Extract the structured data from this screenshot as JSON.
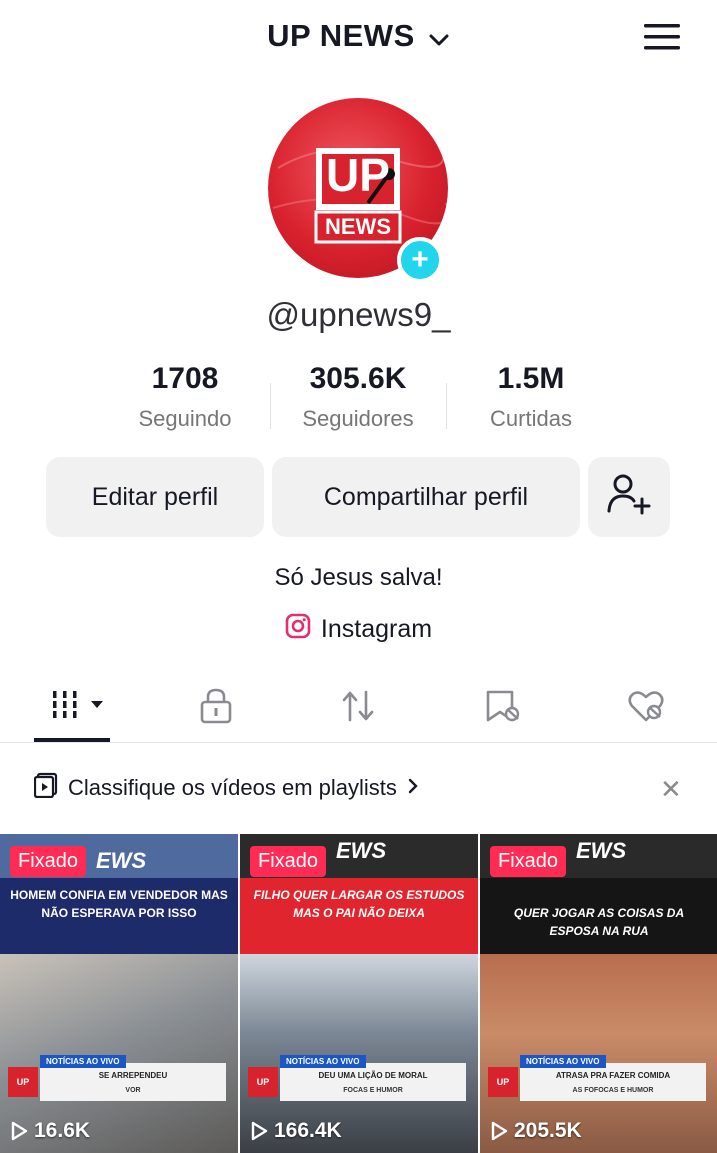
{
  "header": {
    "title": "UP NEWS"
  },
  "avatar": {
    "logo_top": "UP",
    "logo_bottom": "NEWS"
  },
  "profile": {
    "handle": "@upnews9_",
    "bio": "Só Jesus salva!",
    "link_label": "Instagram"
  },
  "stats": [
    {
      "value": "1708",
      "label": "Seguindo"
    },
    {
      "value": "305.6K",
      "label": "Seguidores"
    },
    {
      "value": "1.5M",
      "label": "Curtidas"
    }
  ],
  "buttons": {
    "edit": "Editar perfil",
    "share": "Compartilhar perfil"
  },
  "tabs": [
    "videos-grid-icon",
    "lock-icon",
    "repost-icon",
    "favorites-icon",
    "liked-hidden-icon"
  ],
  "playlist_prompt": "Classifique os vídeos em playlists",
  "videos": [
    {
      "pinned": "Fixado",
      "brand_tail": "EWS",
      "headline": "HOMEM CONFIA EM VENDEDOR MAS NÃO ESPERAVA POR ISSO",
      "tag": "NOTÍCIAS AO VIVO",
      "lower_text": "SE ARREPENDEU",
      "lower_sub": "VOR",
      "views": "16.6K"
    },
    {
      "pinned": "Fixado",
      "brand_tail": "EWS",
      "headline": "FILHO QUER LARGAR OS ESTUDOS MAS O PAI NÃO DEIXA",
      "tag": "NOTÍCIAS AO VIVO",
      "lower_text": "DEU UMA LIÇÃO DE MORAL",
      "lower_sub": "FOCAS E HUMOR",
      "views": "166.4K"
    },
    {
      "pinned": "Fixado",
      "brand_tail": "EWS",
      "headline": "QUER JOGAR AS COISAS DA ESPOSA NA RUA",
      "tag": "NOTÍCIAS AO VIVO",
      "lower_text": "ATRASA PRA FAZER COMIDA",
      "lower_sub": "AS FOFOCAS E HUMOR",
      "views": "205.5K"
    }
  ],
  "colors": {
    "accent": "#fe2c55",
    "avatar_red": "#d8222e",
    "add_badge": "#20d5ec",
    "button_bg": "#f1f1f2"
  }
}
